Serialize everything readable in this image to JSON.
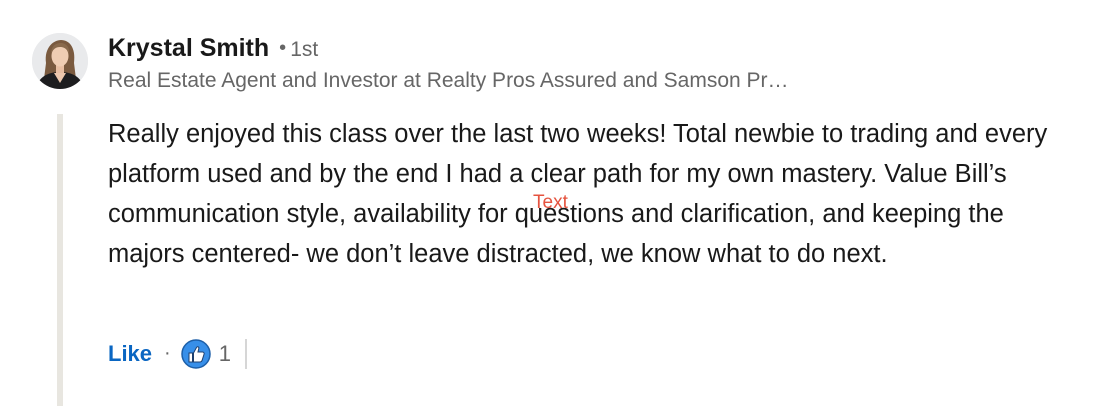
{
  "comment": {
    "author": {
      "name": "Krystal Smith",
      "separator": "•",
      "degree": "1st",
      "headline": "Real Estate Agent and Investor at Realty Pros Assured and Samson Pr…",
      "avatar_icon": "profile-photo"
    },
    "body": "Really enjoyed this class over the last two weeks! Total newbie to trading and every platform used and by the end I had a clear path for my own mastery. Value Bill’s communication style, availability for questions and clarification, and keeping the majors centered- we don’t leave distracted, we know what to do next.",
    "overlay_label": "Text",
    "actions": {
      "like_label": "Like",
      "separator": "·",
      "reaction_icon": "thumbs-up-icon",
      "reaction_count": "1"
    }
  },
  "colors": {
    "accent": "#0a66c2",
    "secondary_text": "#666666",
    "primary_text": "#191919",
    "overlay": "#e5533f",
    "thread_line": "#e8e6e0"
  }
}
